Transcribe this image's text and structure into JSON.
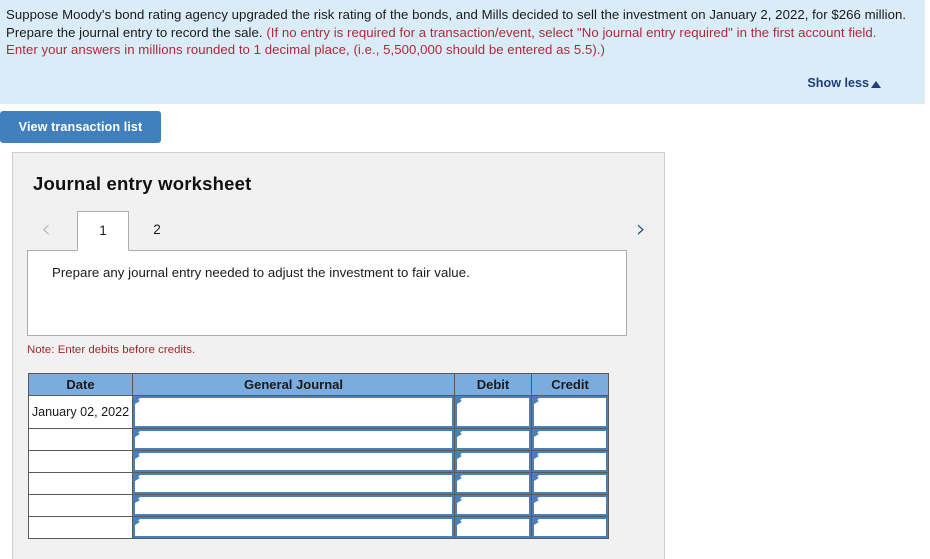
{
  "banner": {
    "paragraph_black": "Suppose Moody's bond rating agency upgraded the risk rating of the bonds, and Mills decided to sell the investment on January 2, 2022, for $266 million. Prepare the journal entry to record the sale. ",
    "paragraph_red": "(If no entry is required for a transaction/event, select \"No journal entry required\" in the first account field. Enter your answers in millions rounded to 1 decimal place, (i.e., 5,500,000 should be entered as 5.5).)",
    "show_less_label": "Show less",
    "background_color": "#d9ecf7",
    "red_text_color": "#b02a37",
    "link_color": "#1f3f7a"
  },
  "toolbar": {
    "view_transaction_list_label": "View transaction list",
    "button_color": "#4080bf"
  },
  "worksheet": {
    "title": "Journal entry worksheet",
    "tabs": [
      {
        "label": "1",
        "active": true
      },
      {
        "label": "2",
        "active": false
      }
    ],
    "prev_arrow": "‹",
    "next_arrow": "›",
    "instruction": "Prepare any journal entry needed to adjust the investment to fair value.",
    "note": "Note: Enter debits before credits.",
    "note_color": "#9c2a2a"
  },
  "journal_table": {
    "header_color": "#7bacde",
    "columns": [
      "Date",
      "General Journal",
      "Debit",
      "Credit"
    ],
    "rows": [
      {
        "date": "January 02, 2022",
        "general_journal": "",
        "debit": "",
        "credit": ""
      },
      {
        "date": "",
        "general_journal": "",
        "debit": "",
        "credit": ""
      },
      {
        "date": "",
        "general_journal": "",
        "debit": "",
        "credit": ""
      },
      {
        "date": "",
        "general_journal": "",
        "debit": "",
        "credit": ""
      },
      {
        "date": "",
        "general_journal": "",
        "debit": "",
        "credit": ""
      },
      {
        "date": "",
        "general_journal": "",
        "debit": "",
        "credit": ""
      }
    ]
  }
}
